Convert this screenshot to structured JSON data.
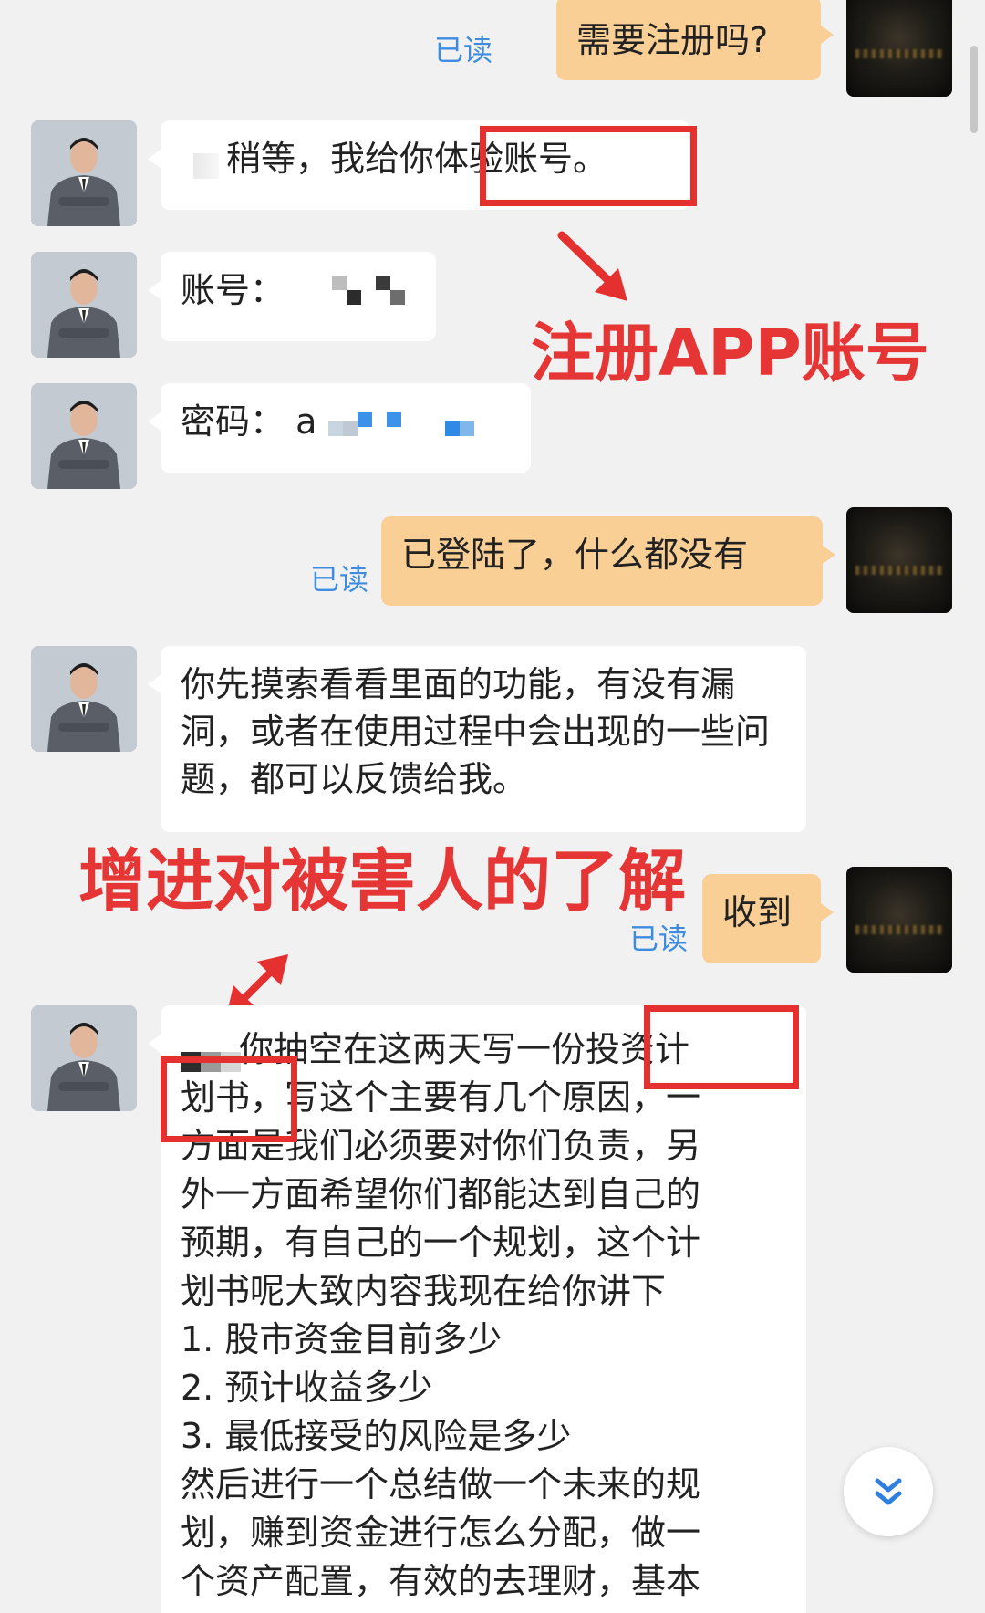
{
  "messages": {
    "m1": {
      "text": "需要注册吗?",
      "status": "已读"
    },
    "m2": {
      "text": "稍等，我给你体验账号。"
    },
    "m3": {
      "label": "账号："
    },
    "m4": {
      "label": "密码：",
      "visible_prefix": "a"
    },
    "m5": {
      "text": "已登陆了，什么都没有",
      "status": "已读"
    },
    "m6": {
      "text": "你先摸索看看里面的功能，有没有漏洞，或者在使用过程中会出现的一些问题，都可以反馈给我。"
    },
    "m7": {
      "text": "收到",
      "status": "已读"
    },
    "m8": {
      "lines": [
        "你抽空在这两天写一份投资计",
        "划书，写这个主要有几个原因，一",
        "方面是我们必须要对你们负责，另",
        "外一方面希望你们都能达到自己的",
        "预期，有自己的一个规划，这个计",
        "划书呢大致内容我现在给你讲下",
        "1. 股市资金目前多少",
        "2. 预计收益多少",
        "3. 最低接受的风险是多少",
        "然后进行一个总结做一个未来的规",
        "划，赚到资金进行怎么分配，做一",
        "个资产配置，有效的去理财，基本"
      ]
    }
  },
  "annotations": {
    "register_app_account": "注册APP账号",
    "understand_victim": "增进对被害人的了解"
  },
  "colors": {
    "background": "#f1f1f1",
    "incoming_bubble": "#ffffff",
    "outgoing_bubble": "#f9cf95",
    "read_status": "#3d8ce0",
    "annotation_red": "#e53030"
  },
  "icons": {
    "scroll_down": "double-chevron-down-icon"
  }
}
